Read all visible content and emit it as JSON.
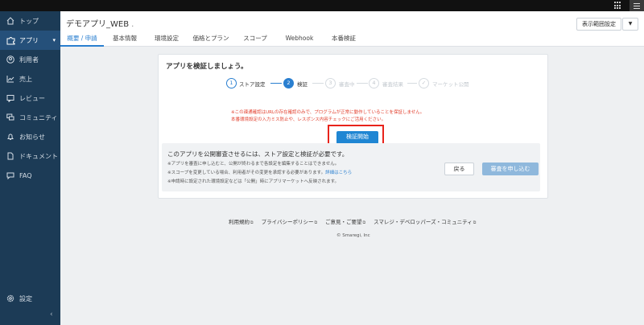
{
  "sidebar": {
    "items": [
      {
        "label": "トップ",
        "icon": "home-icon"
      },
      {
        "label": "アプリ",
        "icon": "puzzle-icon",
        "active": true
      },
      {
        "label": "利用者",
        "icon": "user-icon"
      },
      {
        "label": "売上",
        "icon": "chart-icon"
      },
      {
        "label": "レビュー",
        "icon": "review-icon"
      },
      {
        "label": "コミュニティ",
        "icon": "community-icon"
      },
      {
        "label": "お知らせ",
        "icon": "bell-icon"
      },
      {
        "label": "ドキュメント",
        "icon": "document-icon"
      },
      {
        "label": "FAQ",
        "icon": "faq-icon"
      }
    ],
    "settings_label": "設定",
    "collapse_glyph": "‹"
  },
  "header": {
    "app_name": "デモアプリ_WEB",
    "app_name_suffix": ".",
    "tabs": [
      "概要 / 申請",
      "基本情報",
      "環境設定",
      "価格とプラン",
      "スコープ",
      "Webhook",
      "本番検証"
    ],
    "scope_button": "表示範囲設定"
  },
  "card": {
    "title": "アプリを検証しましょう。",
    "steps": [
      {
        "num": "1",
        "label": "ストア設定"
      },
      {
        "num": "2",
        "label": "検証"
      },
      {
        "num": "3",
        "label": "審査中"
      },
      {
        "num": "4",
        "label": "審査結果"
      },
      {
        "num": "✓",
        "label": "マーケット公開"
      }
    ],
    "warning_1": "※この疎通確認はURLの存在確認のみで、プログラムが正常に動作していることを保証しません。",
    "warning_2": "本番環境設定の入力ミス防止や、レスポンス内容チェックにご活用ください。",
    "verify_button": "検証開始",
    "info_main": "このアプリを公開審査させるには、ストア設定と検証が必要です。",
    "info_note_1": "※アプリを審査に申し込むと、公開が終わるまで各設定を編集することはできません。",
    "info_note_2": "※スコープを変更している場合、利用者がその変更を承認する必要があります。",
    "info_note_2_link": "詳細はこちら",
    "info_note_3": "※申請時に設定された環境設定などは「公開」時にアプリマーケットへ反映されます。",
    "back_button": "戻る",
    "apply_button": "審査を申し込む"
  },
  "footer": {
    "links": [
      "利用規約",
      "プライバシーポリシー",
      "ご意見・ご要望",
      "スマレジ・デベロッパーズ・コミュニティ"
    ],
    "copyright": "© Smaregi, Inc"
  },
  "colors": {
    "sidebar": "#1c3b56",
    "accent": "#2a7fd0",
    "highlight": "#e8231b"
  }
}
